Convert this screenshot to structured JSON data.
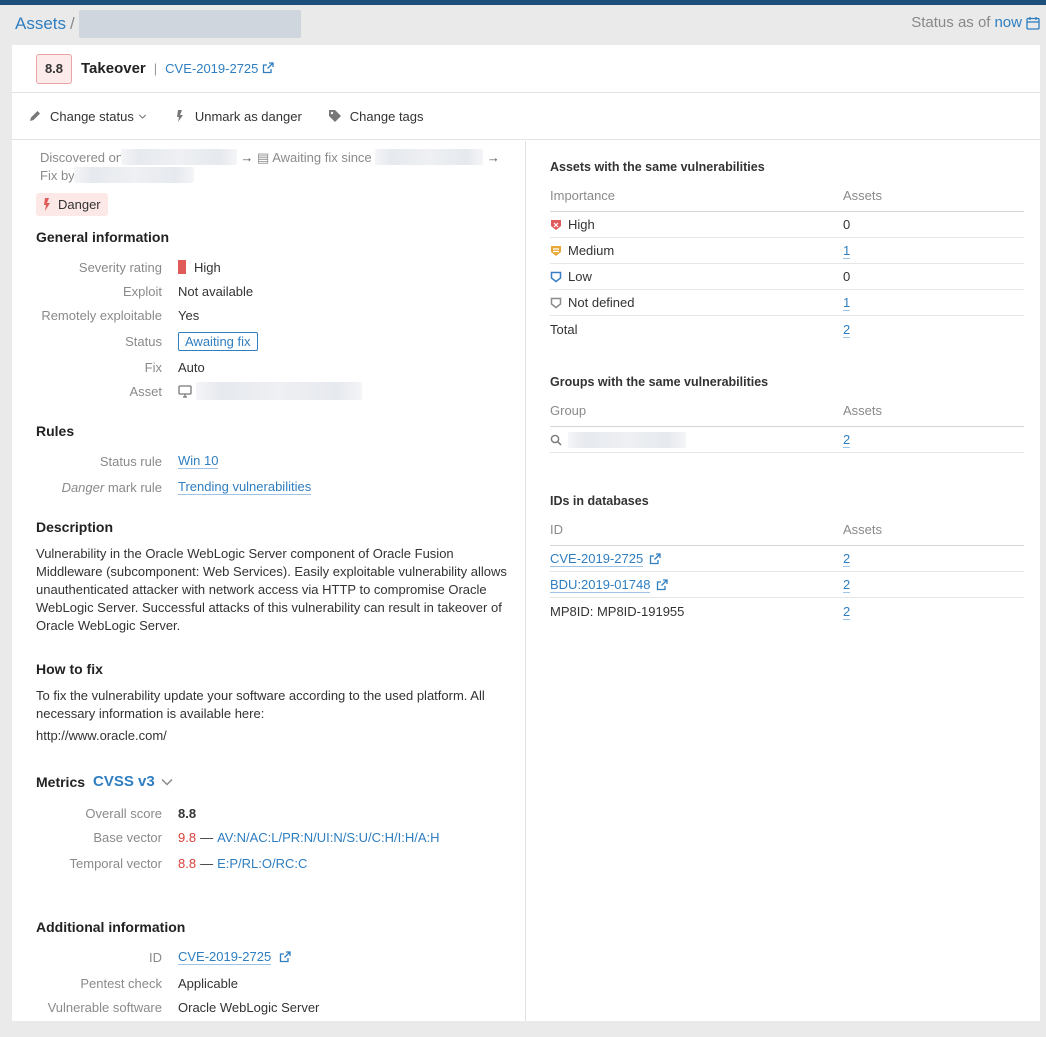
{
  "breadcrumb": {
    "root": "Assets",
    "separator": "/"
  },
  "status_as_of": {
    "label": "Status as of",
    "link": "now"
  },
  "vuln": {
    "score": "8.8",
    "title": "Takeover",
    "cve": "CVE-2019-2725"
  },
  "toolbar": {
    "change_status": "Change status",
    "unmark_danger": "Unmark as danger",
    "change_tags": "Change tags"
  },
  "timeline": {
    "discovered": "Discovered on",
    "awaiting": "Awaiting fix since",
    "fix_by": "Fix by"
  },
  "danger_tag": "Danger",
  "general": {
    "title": "General information",
    "severity_label": "Severity rating",
    "severity_value": "High",
    "exploit_label": "Exploit",
    "exploit_value": "Not available",
    "remote_label": "Remotely exploitable",
    "remote_value": "Yes",
    "status_label": "Status",
    "status_value": "Awaiting fix",
    "fix_label": "Fix",
    "fix_value": "Auto",
    "asset_label": "Asset"
  },
  "rules": {
    "title": "Rules",
    "status_rule_label": "Status rule",
    "status_rule_value": "Win 10",
    "danger_word": "Danger",
    "danger_rest": " mark rule",
    "danger_rule_value": "Trending vulnerabilities"
  },
  "description": {
    "title": "Description",
    "text": "Vulnerability in the Oracle WebLogic Server component of Oracle Fusion Middleware (subcomponent: Web Services). Easily exploitable vulnerability allows unauthenticated attacker with network access via HTTP to compromise Oracle WebLogic Server. Successful attacks of this vulnerability can result in takeover of Oracle WebLogic Server."
  },
  "how_to_fix": {
    "title": "How to fix",
    "text": "To fix the vulnerability update your software according to the used platform. All necessary information is available here:",
    "url": "http://www.oracle.com/"
  },
  "metrics": {
    "title": "Metrics",
    "version": "CVSS v3",
    "overall_label": "Overall score",
    "overall_value": "8.8",
    "base_label": "Base vector",
    "base_score": "9.8",
    "base_vector": "AV:N/AC:L/PR:N/UI:N/S:U/C:H/I:H/A:H",
    "temporal_label": "Temporal vector",
    "temporal_score": "8.8",
    "temporal_vector": "E:P/RL:O/RC:C",
    "dash": "—"
  },
  "additional": {
    "title": "Additional information",
    "id_label": "ID",
    "id_value": "CVE-2019-2725",
    "pentest_label": "Pentest check",
    "pentest_value": "Applicable",
    "software_label": "Vulnerable software",
    "software_value": "Oracle WebLogic Server"
  },
  "assets_same": {
    "title": "Assets with the same vulnerabilities",
    "col1": "Importance",
    "col2": "Assets",
    "rows": [
      {
        "label": "High",
        "count": "0",
        "color": "#e05a5a"
      },
      {
        "label": "Medium",
        "count": "1",
        "color": "#e8a93a"
      },
      {
        "label": "Low",
        "count": "0",
        "color": "#3a7fc6"
      },
      {
        "label": "Not defined",
        "count": "1",
        "color": "#8a8a8a"
      }
    ],
    "total_label": "Total",
    "total_count": "2"
  },
  "groups_same": {
    "title": "Groups with the same vulnerabilities",
    "col1": "Group",
    "col2": "Assets",
    "count": "2"
  },
  "ids_db": {
    "title": "IDs in databases",
    "col1": "ID",
    "col2": "Assets",
    "rows": [
      {
        "id": "CVE-2019-2725",
        "count": "2"
      },
      {
        "id": "BDU:2019-01748",
        "count": "2"
      },
      {
        "id": "MP8ID: MP8ID-191955",
        "count": "2"
      }
    ]
  }
}
